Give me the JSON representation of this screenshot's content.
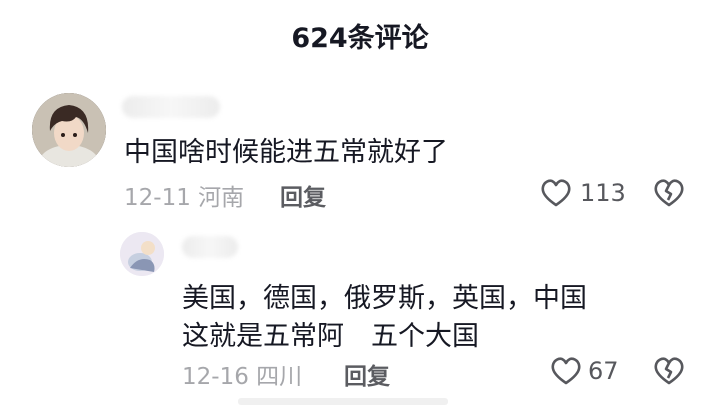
{
  "header": {
    "title": "624条评论"
  },
  "comments": [
    {
      "text_lines": [
        "中国啥时候能进五常就好了"
      ],
      "date": "12-11",
      "location": "河南",
      "reply_label": "回复",
      "likes": "113"
    },
    {
      "text_lines": [
        "美国，德国，俄罗斯，英国，中国",
        "这就是五常阿　五个大国"
      ],
      "date": "12-16",
      "location": "四川",
      "reply_label": "回复",
      "likes": "67"
    }
  ],
  "icons": {
    "like": "heart-outline-icon",
    "dislike": "broken-heart-outline-icon"
  },
  "colors": {
    "text": "#161823",
    "meta": "#a6a7ab",
    "icon": "#57585d"
  }
}
